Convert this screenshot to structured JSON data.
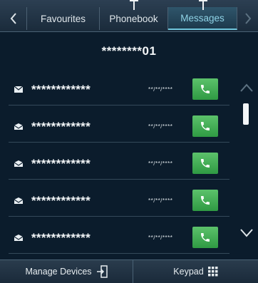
{
  "tabs": {
    "back_icon": "chevron-left-icon",
    "favourites": "Favourites",
    "phonebook": "Phonebook",
    "messages": "Messages",
    "next_icon": "chevron-right-icon"
  },
  "contact": {
    "number": "********01"
  },
  "messages": [
    {
      "name": "************",
      "date": "**/**/****",
      "icon": "envelope-closed-icon"
    },
    {
      "name": "************",
      "date": "**/**/****",
      "icon": "envelope-open-icon"
    },
    {
      "name": "************",
      "date": "**/**/****",
      "icon": "envelope-open-icon"
    },
    {
      "name": "************",
      "date": "**/**/****",
      "icon": "envelope-open-icon"
    },
    {
      "name": "************",
      "date": "**/**/****",
      "icon": "envelope-open-icon"
    }
  ],
  "bottom": {
    "manage_devices": "Manage Devices",
    "keypad": "Keypad"
  },
  "colors": {
    "background": "#0b1c2c",
    "active_tab_text": "#8fd3e6",
    "call_button": "#3fae52"
  }
}
